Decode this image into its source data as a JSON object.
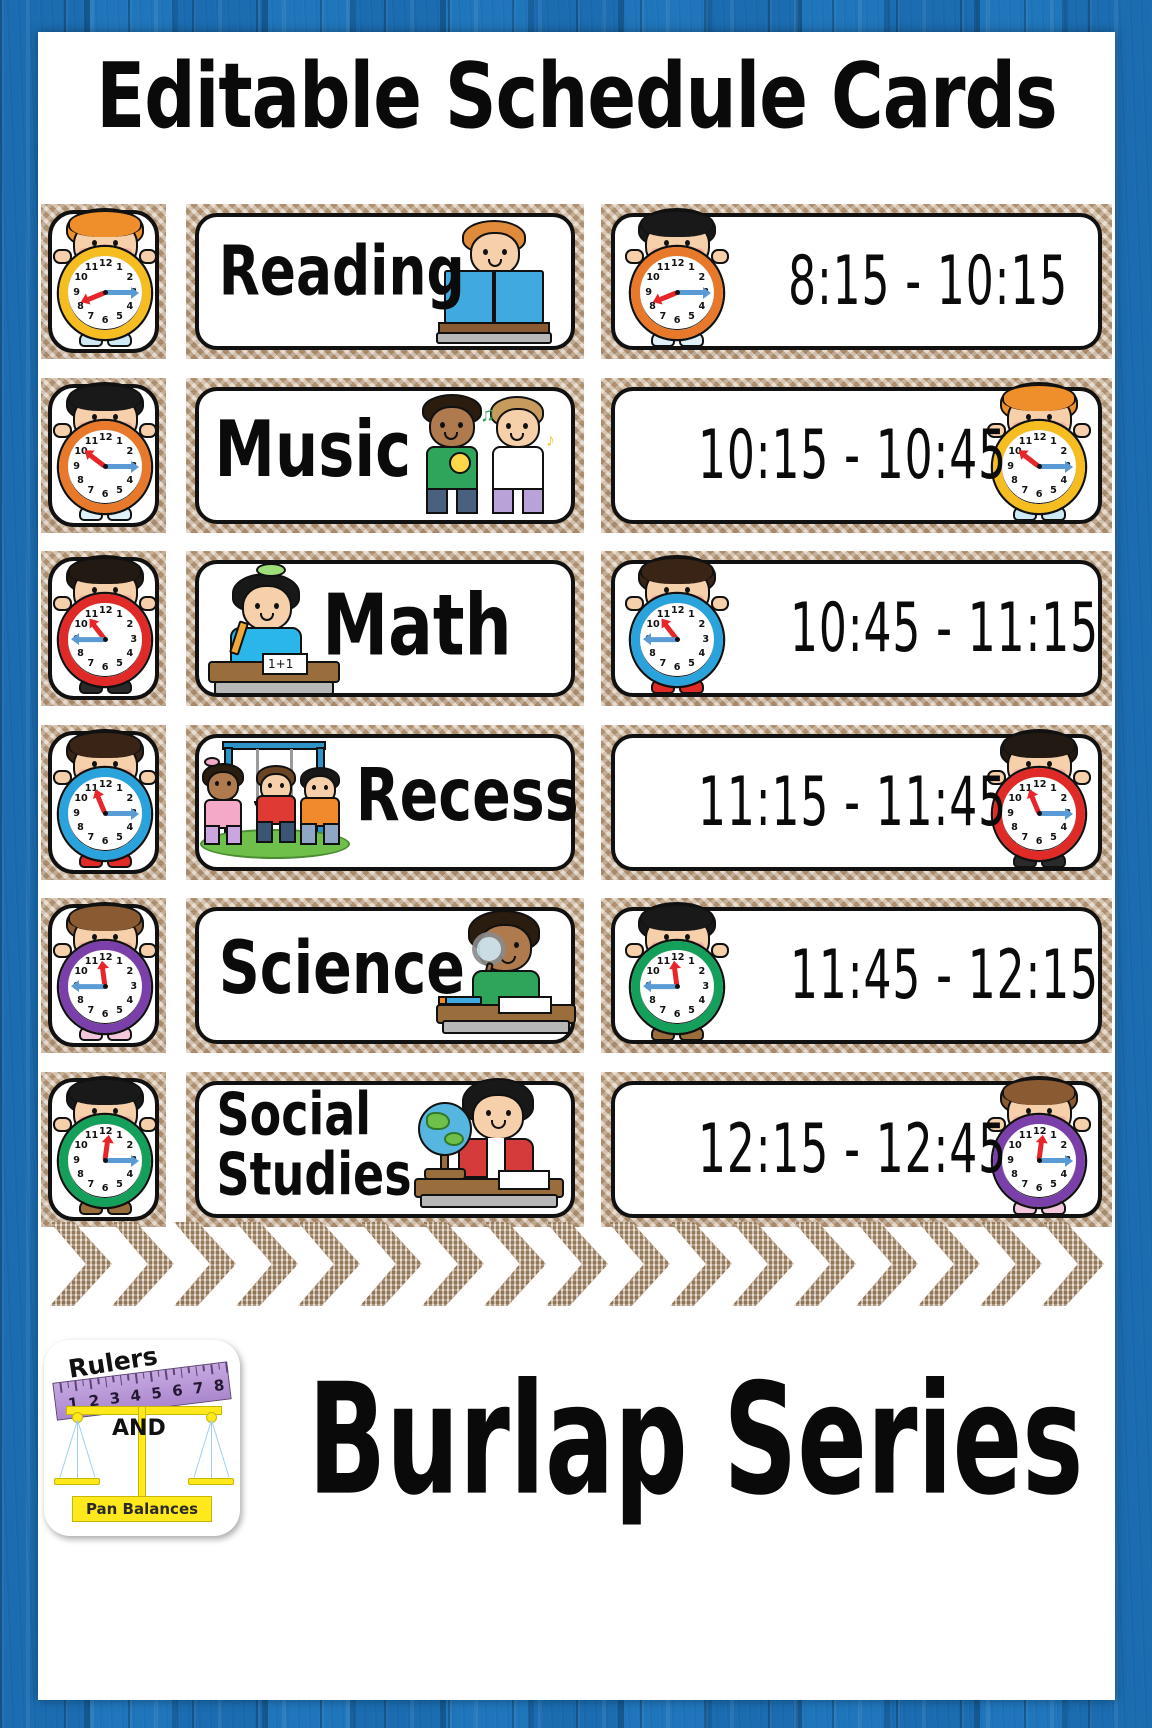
{
  "title": "Editable Schedule Cards",
  "footer": {
    "series_title": "Burlap Series",
    "logo": {
      "rulers_word": "Rulers",
      "and_word": "AND",
      "pan_balances": "Pan Balances",
      "ruler_numbers": [
        "1",
        "2",
        "3",
        "4",
        "5",
        "6",
        "7",
        "8"
      ]
    }
  },
  "clock_numbers": [
    "12",
    "1",
    "2",
    "3",
    "4",
    "5",
    "6",
    "7",
    "8",
    "9",
    "10",
    "11"
  ],
  "colors": {
    "wood_blue": "#1b6cb0",
    "burlap_tan": "#c9ab88",
    "page_white": "#ffffff",
    "ink_black": "#0b0b0b",
    "hour_hand_red": "#e8262a",
    "minute_hand_blue": "#5b9bd5",
    "logo_purple": "#ab87ce",
    "logo_yellow": "#ffe81c"
  },
  "rows": [
    {
      "subject": "Reading",
      "time": "8:15 - 10:15",
      "left_clock_color": "#f5bd1f",
      "left_clock_hour": 8,
      "left_clock_minute": 15,
      "left_hair_color": "#ef8f2c",
      "left_shoe_color": "#cfe8f5",
      "time_clock_color": "#e8792a",
      "time_clock_hour": 8,
      "time_clock_minute": 15,
      "time_hair_color": "#191919",
      "time_shoe_color": "#dff0f8",
      "art": "reading-girl-with-book"
    },
    {
      "subject": "Music",
      "time": "10:15 - 10:45",
      "left_clock_color": "#e8792a",
      "left_clock_hour": 10,
      "left_clock_minute": 15,
      "left_hair_color": "#191919",
      "left_shoe_color": "#dff0f8",
      "time_clock_color": "#f5bd1f",
      "time_clock_hour": 10,
      "time_clock_minute": 15,
      "time_hair_color": "#ef8f2c",
      "time_shoe_color": "#cfe8f5",
      "art": "two-kids-with-instruments"
    },
    {
      "subject": "Math",
      "time": "10:45 - 11:15",
      "left_clock_color": "#e02a28",
      "left_clock_hour": 10,
      "left_clock_minute": 45,
      "left_hair_color": "#221a12",
      "left_shoe_color": "#2a2a2a",
      "time_clock_color": "#2aa3dd",
      "time_clock_hour": 10,
      "time_clock_minute": 45,
      "time_hair_color": "#3a2416",
      "time_shoe_color": "#e02a28",
      "art": "girl-at-desk-with-pencil"
    },
    {
      "subject": "Recess",
      "time": "11:15 - 11:45",
      "left_clock_color": "#2aa3dd",
      "left_clock_hour": 11,
      "left_clock_minute": 15,
      "left_hair_color": "#3a2416",
      "left_shoe_color": "#e02a28",
      "time_clock_color": "#e02a28",
      "time_clock_hour": 11,
      "time_clock_minute": 15,
      "time_hair_color": "#221a12",
      "time_shoe_color": "#2a2a2a",
      "art": "kids-on-swing-set"
    },
    {
      "subject": "Science",
      "time": "11:45 - 12:15",
      "left_clock_color": "#7a3fa8",
      "left_clock_hour": 11,
      "left_clock_minute": 45,
      "left_hair_color": "#8a5a33",
      "left_shoe_color": "#f3c8dd",
      "time_clock_color": "#14a05a",
      "time_clock_hour": 11,
      "time_clock_minute": 45,
      "time_hair_color": "#191919",
      "time_shoe_color": "#9a6d3c",
      "art": "boy-with-magnifying-glass"
    },
    {
      "subject": "Social\nStudies",
      "time": "12:15 - 12:45",
      "left_clock_color": "#14a05a",
      "left_clock_hour": 12,
      "left_clock_minute": 15,
      "left_hair_color": "#191919",
      "left_shoe_color": "#9a6d3c",
      "time_clock_color": "#7a3fa8",
      "time_clock_hour": 12,
      "time_clock_minute": 15,
      "time_hair_color": "#8a5a33",
      "time_shoe_color": "#f3c8dd",
      "art": "girl-with-globe"
    }
  ]
}
